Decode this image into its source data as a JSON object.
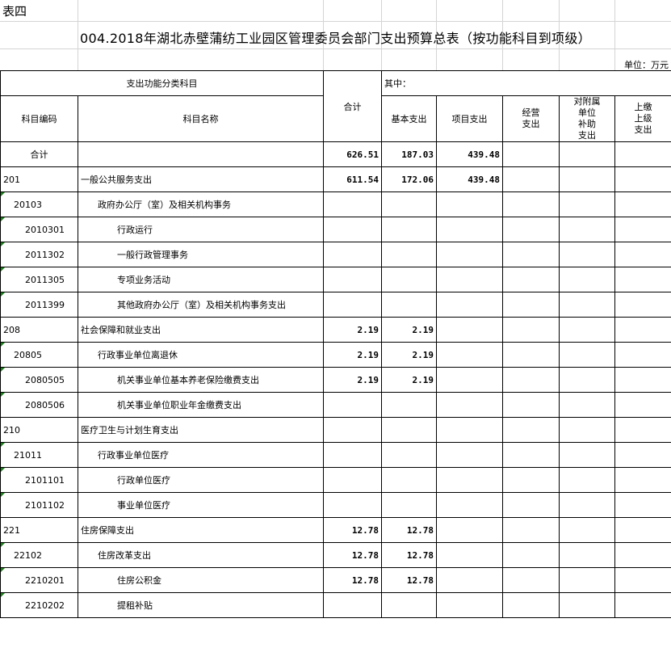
{
  "sheet_label": "表四",
  "title": "004.2018年湖北赤壁蒲纺工业园区管理委员会部门支出预算总表（按功能科目到项级）",
  "unit": "单位：万元",
  "header": {
    "category": "支出功能分类科目",
    "total": "合计",
    "of_which": "其中：",
    "code": "科目编码",
    "name": "科目名称",
    "basic": "基本支出",
    "project": "项目支出",
    "operating": "经营\n支出",
    "subsidy": "对附属\n单位\n补助\n支出",
    "remit": "上缴\n上级\n支出"
  },
  "rows": [
    {
      "code": "合计",
      "name": "",
      "total": "626.51",
      "basic": "187.03",
      "project": "439.48",
      "level": 0,
      "is_total": true
    },
    {
      "code": "201",
      "name": "一般公共服务支出",
      "total": "611.54",
      "basic": "172.06",
      "project": "439.48",
      "level": 1
    },
    {
      "code": "20103",
      "name": "政府办公厅（室）及相关机构事务",
      "total": "",
      "basic": "",
      "project": "",
      "level": 2
    },
    {
      "code": "2010301",
      "name": "行政运行",
      "total": "",
      "basic": "",
      "project": "",
      "level": 3
    },
    {
      "code": "2011302",
      "name": "一般行政管理事务",
      "total": "",
      "basic": "",
      "project": "",
      "level": 3
    },
    {
      "code": "2011305",
      "name": "专项业务活动",
      "total": "",
      "basic": "",
      "project": "",
      "level": 3
    },
    {
      "code": "2011399",
      "name": "其他政府办公厅（室）及相关机构事务支出",
      "total": "",
      "basic": "",
      "project": "",
      "level": 3
    },
    {
      "code": "208",
      "name": "社会保障和就业支出",
      "total": "2.19",
      "basic": "2.19",
      "project": "",
      "level": 1
    },
    {
      "code": "20805",
      "name": "行政事业单位离退休",
      "total": "2.19",
      "basic": "2.19",
      "project": "",
      "level": 2
    },
    {
      "code": "2080505",
      "name": "机关事业单位基本养老保险缴费支出",
      "total": "2.19",
      "basic": "2.19",
      "project": "",
      "level": 3
    },
    {
      "code": "2080506",
      "name": "机关事业单位职业年金缴费支出",
      "total": "",
      "basic": "",
      "project": "",
      "level": 3
    },
    {
      "code": "210",
      "name": "医疗卫生与计划生育支出",
      "total": "",
      "basic": "",
      "project": "",
      "level": 1
    },
    {
      "code": "21011",
      "name": "行政事业单位医疗",
      "total": "",
      "basic": "",
      "project": "",
      "level": 2
    },
    {
      "code": "2101101",
      "name": "行政单位医疗",
      "total": "",
      "basic": "",
      "project": "",
      "level": 3
    },
    {
      "code": "2101102",
      "name": "事业单位医疗",
      "total": "",
      "basic": "",
      "project": "",
      "level": 3
    },
    {
      "code": "221",
      "name": "住房保障支出",
      "total": "12.78",
      "basic": "12.78",
      "project": "",
      "level": 1
    },
    {
      "code": "22102",
      "name": "住房改革支出",
      "total": "12.78",
      "basic": "12.78",
      "project": "",
      "level": 2
    },
    {
      "code": "2210201",
      "name": "住房公积金",
      "total": "12.78",
      "basic": "12.78",
      "project": "",
      "level": 3
    },
    {
      "code": "2210202",
      "name": "提租补贴",
      "total": "",
      "basic": "",
      "project": "",
      "level": 3
    }
  ]
}
